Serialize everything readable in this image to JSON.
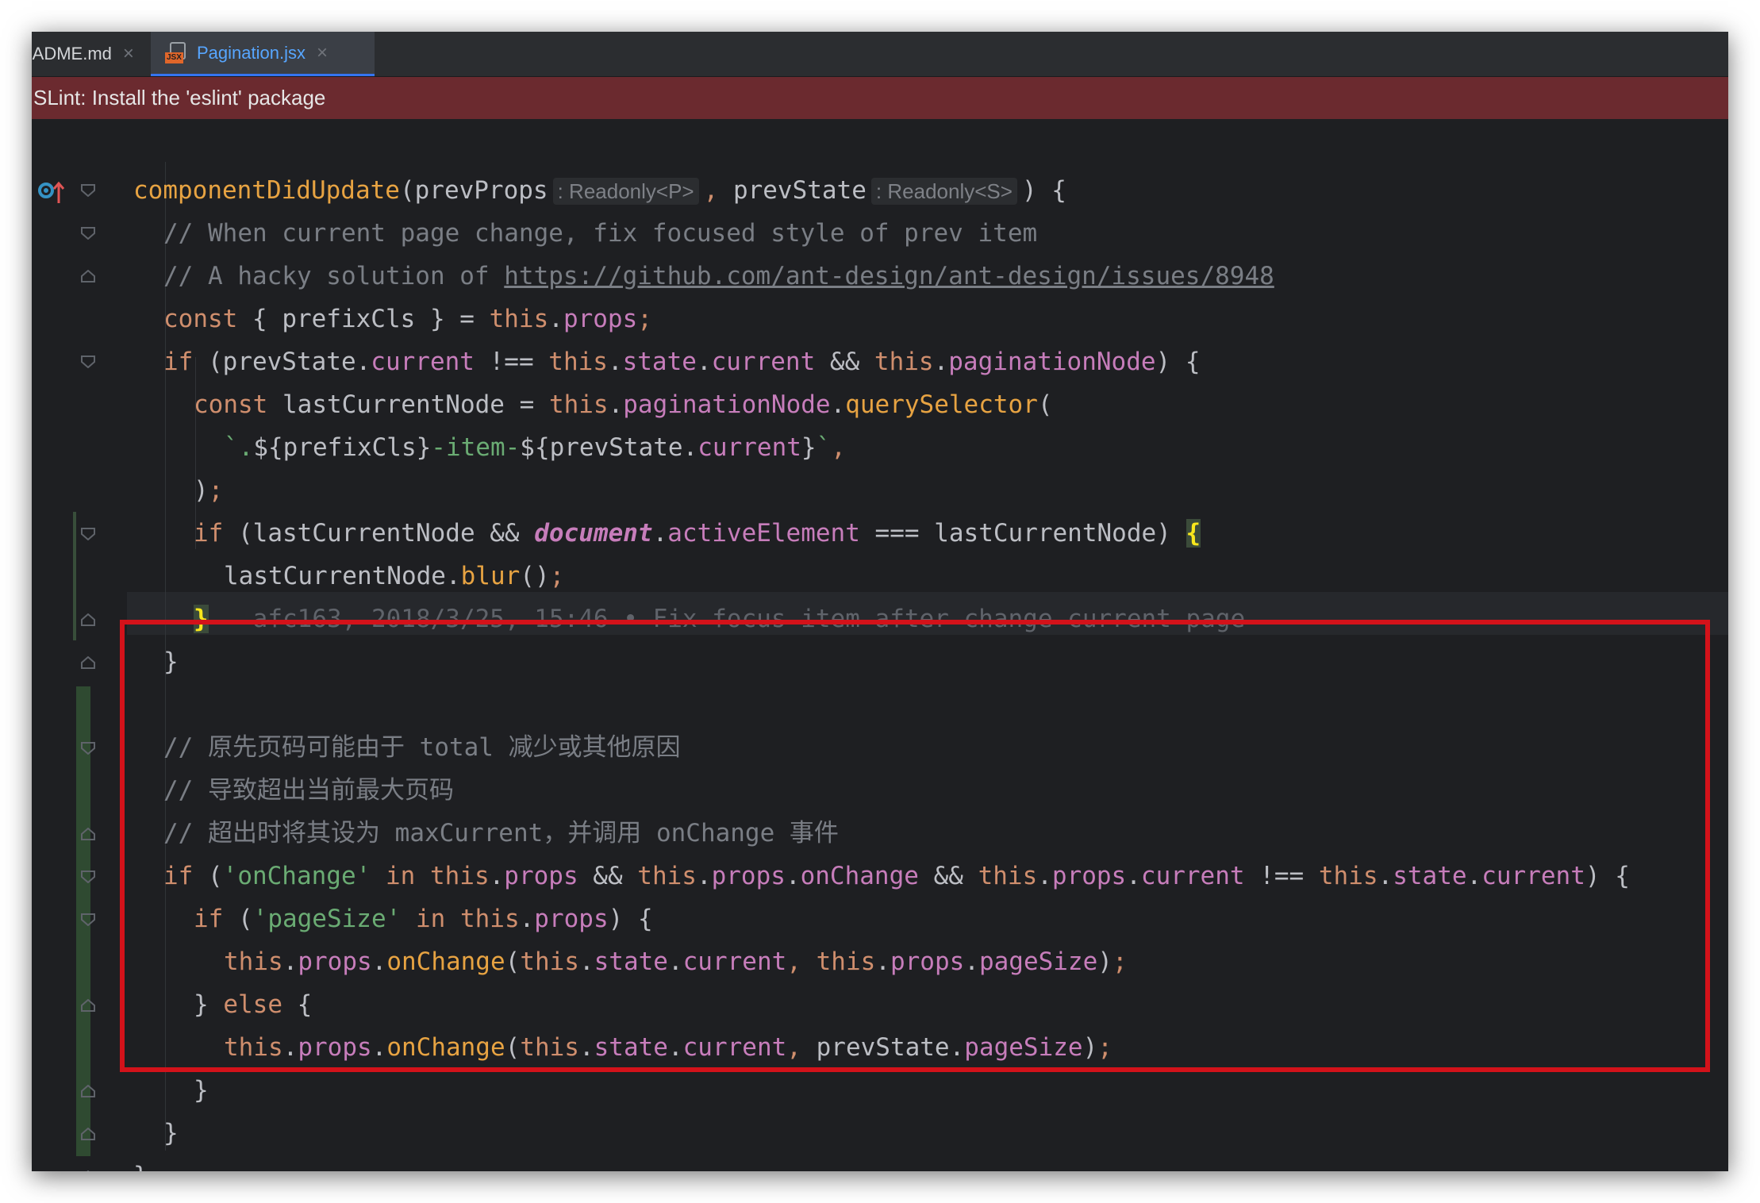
{
  "tabs": [
    {
      "label": "EADME.md",
      "active": false
    },
    {
      "label": "Pagination.jsx",
      "active": true
    }
  ],
  "jsx_badge": "JSX",
  "tab_close_glyph": "×",
  "banner": {
    "text": "SLint: Install the 'eslint' package"
  },
  "hints": {
    "prevProps_type": ": Readonly<P>",
    "prevState_type": ": Readonly<S>"
  },
  "comments": {
    "c1": "// When current page change, fix focused style of prev item",
    "c2_prefix": "// A hacky solution of ",
    "c2_link": "https://github.com/ant-design/ant-design/issues/8948",
    "c3": "// 原先页码可能由于 total 减少或其他原因",
    "c4": "// 导致超出当前最大页码",
    "c5": "// 超出时将其设为 maxCurrent，并调用 onChange 事件"
  },
  "blame": "afc163, 2018/3/25, 15:46 • Fix focus item after change current page",
  "colors": {
    "background": "#1e1f22",
    "tabbar": "#2b2d30",
    "banner": "#6b2a2f",
    "keyword": "#cf8e6d",
    "method": "#56a8f5",
    "property": "#c77dbb",
    "string": "#6aab73",
    "comment": "#7a7e85",
    "highlight_box": "#d3121a"
  },
  "icons": [
    "jsx-file-icon",
    "close-icon",
    "override-up-icon",
    "fold-icon"
  ]
}
